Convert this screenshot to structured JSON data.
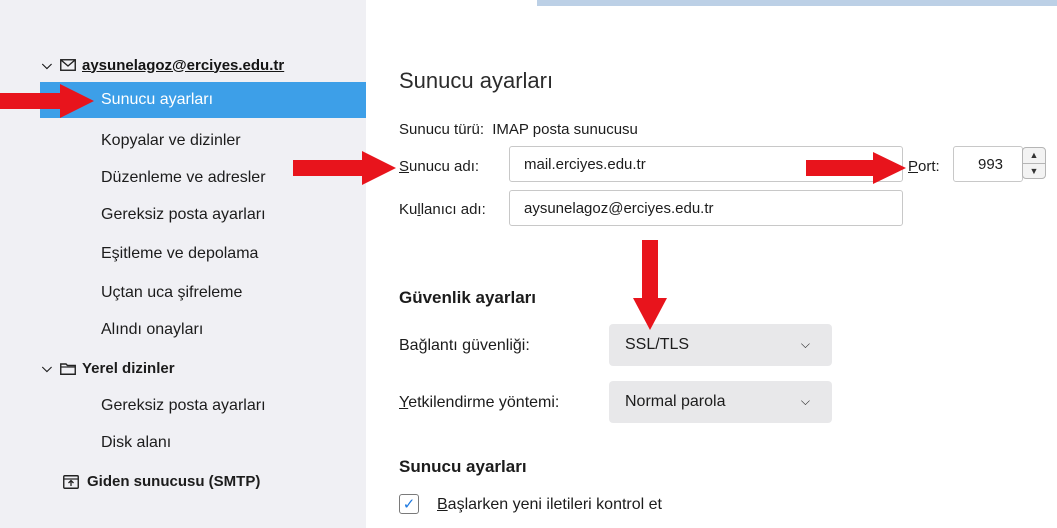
{
  "sidebar": {
    "account": {
      "label": "aysunelagoz@erciyes.edu.tr",
      "icon": "envelope-icon"
    },
    "items": [
      {
        "label": "Sunucu ayarları",
        "selected": true
      },
      {
        "label": "Kopyalar ve dizinler"
      },
      {
        "label": "Düzenleme ve adresler"
      },
      {
        "label": "Gereksiz posta ayarları"
      },
      {
        "label": "Eşitleme ve depolama"
      },
      {
        "label": "Uçtan uca şifreleme"
      },
      {
        "label": "Alındı onayları"
      }
    ],
    "local": {
      "label": "Yerel dizinler",
      "icon": "folder-icon",
      "items": [
        {
          "label": "Gereksiz posta ayarları"
        },
        {
          "label": "Disk alanı"
        }
      ]
    },
    "smtp": {
      "label": "Giden sunucusu (SMTP)",
      "icon": "outgoing-server-icon"
    }
  },
  "main": {
    "title": "Sunucu ayarları",
    "server_type_label": "Sunucu türü:",
    "server_type_value": "IMAP posta sunucusu",
    "server_name_label_u": "S",
    "server_name_label_rest": "unucu adı:",
    "server_name_value": "mail.erciyes.edu.tr",
    "port_label_u": "P",
    "port_label_rest": "ort:",
    "port_value": "993",
    "username_label_a": "Ku",
    "username_label_u": "l",
    "username_label_b": "lanıcı adı:",
    "username_value": "aysunelagoz@erciyes.edu.tr",
    "security": {
      "title": "Güvenlik ayarları",
      "conn_label_a": "Bağlantı ",
      "conn_label_u": "g",
      "conn_label_b": "üvenliği:",
      "conn_value": "SSL/TLS",
      "auth_label_u": "Y",
      "auth_label_rest": "etkilendirme yöntemi:",
      "auth_value": "Normal parola"
    },
    "server_settings": {
      "title": "Sunucu ayarları",
      "check_label_u": "B",
      "check_label_rest": "aşlarken yeni iletileri kontrol et",
      "checked": true
    }
  },
  "colors": {
    "selected_bg": "#3d9fe8",
    "arrow_red": "#e8141c",
    "sidebar_bg": "#f0f0f4"
  }
}
